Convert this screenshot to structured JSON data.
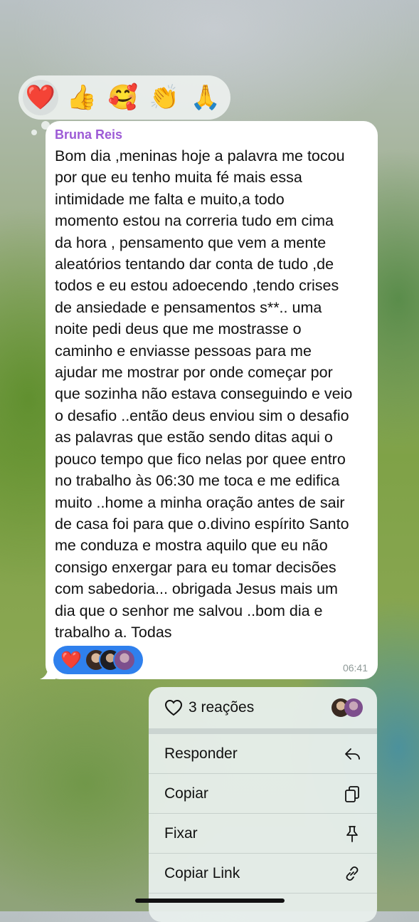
{
  "reaction_picker": {
    "emojis": [
      "❤️",
      "👍",
      "🥰",
      "👏",
      "🙏"
    ],
    "selected_index": 0
  },
  "message": {
    "sender": "Bruna Reis",
    "text": "Bom dia ,meninas hoje a palavra me tocou\npor que eu tenho muita fé mais essa\nintimidade me falta e muito,a todo\nmomento estou na correria tudo em cima\nda hora , pensamento que vem a mente\naleatórios tentando dar conta de tudo ,de\ntodos e eu estou adoecendo ,tendo crises\nde ansiedade e pensamentos s**.. uma\nnoite pedi deus que me mostrasse o\ncaminho e enviasse pessoas para me\najudar me mostrar por onde começar por\nque sozinha não estava conseguindo e veio\no desafio ..então deus enviou sim o desafio\nas palavras que estão sendo ditas aqui  o\npouco tempo que fico nelas por quee entro\nno trabalho às 06:30 me toca e me edifica\nmuito ..home a minha oração antes de sair\nde casa foi para que o.divino espírito Santo\nme conduza e mostra aquilo que eu não\nconsigo enxergar para eu tomar decisões\ncom sabedoria... obrigada Jesus mais um\ndia que o senhor me salvou ..bom dia e\ntrabalho a. Todas",
    "reaction_emoji": "❤️",
    "time": "06:41"
  },
  "context_menu": {
    "reactions_label": "3 reações",
    "items": [
      {
        "label": "Responder",
        "icon": "reply-icon"
      },
      {
        "label": "Copiar",
        "icon": "copy-icon"
      },
      {
        "label": "Fixar",
        "icon": "pin-icon"
      },
      {
        "label": "Copiar Link",
        "icon": "link-icon"
      }
    ]
  },
  "colors": {
    "sender_name": "#9d5bd6",
    "reaction_pill": "#2f80ed",
    "heart": "#e02424"
  }
}
